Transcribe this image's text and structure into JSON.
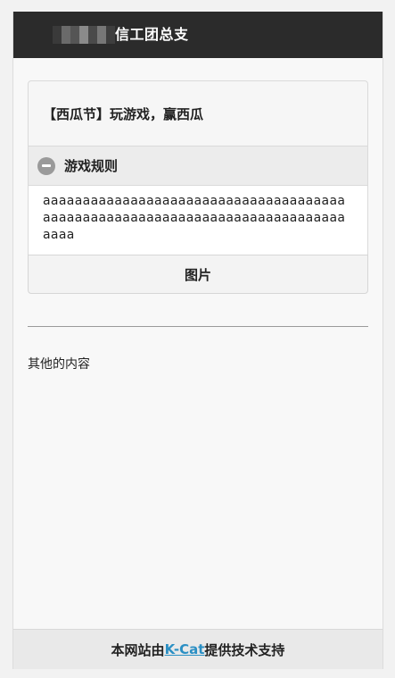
{
  "header": {
    "title": "信工团总支",
    "background": "#2b2b2b"
  },
  "card": {
    "title": "【西瓜节】玩游戏，赢西瓜"
  },
  "rules": {
    "heading": "游戏规则",
    "icon": "minus-circle-icon",
    "content": "aaaaaaaaaaaaaaaaaaaaaaaaaaaaaaaaaaaaaaaaaaaaaaaaaaaaaaaaaaaaaaaaaaaaaaaaaaaaaaaa"
  },
  "image_button": {
    "label": "图片"
  },
  "other": {
    "text": "其他的内容"
  },
  "footer": {
    "prefix": "本网站由",
    "link": "K-Cat",
    "suffix": "提供技术支持",
    "link_color": "#2a8fc4"
  }
}
